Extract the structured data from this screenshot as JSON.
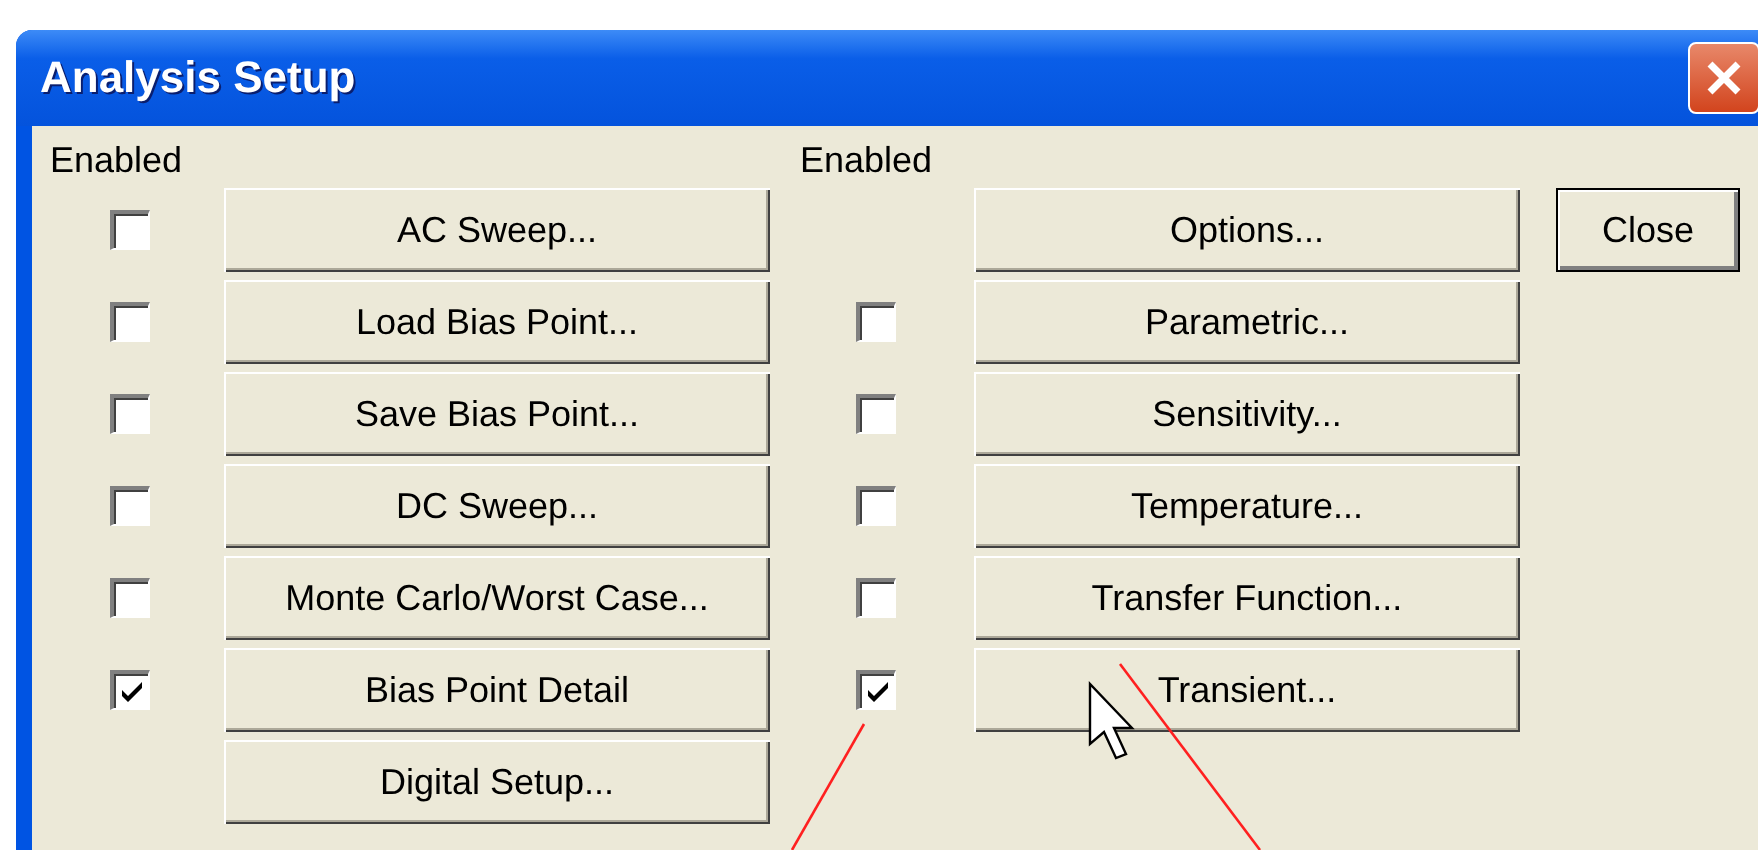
{
  "window": {
    "title": "Analysis Setup"
  },
  "left": {
    "header": "Enabled",
    "rows": [
      {
        "kind": "check",
        "checked": false,
        "label": "AC Sweep..."
      },
      {
        "kind": "check",
        "checked": false,
        "label": "Load Bias Point..."
      },
      {
        "kind": "check",
        "checked": false,
        "label": "Save Bias Point..."
      },
      {
        "kind": "check",
        "checked": false,
        "label": "DC Sweep..."
      },
      {
        "kind": "check",
        "checked": false,
        "label": "Monte Carlo/Worst Case..."
      },
      {
        "kind": "check",
        "checked": true,
        "label": "Bias Point Detail"
      },
      {
        "kind": "plain",
        "label": "Digital Setup..."
      }
    ]
  },
  "right": {
    "header": "Enabled",
    "rows": [
      {
        "kind": "plain",
        "label": "Options..."
      },
      {
        "kind": "check",
        "checked": false,
        "label": "Parametric..."
      },
      {
        "kind": "check",
        "checked": false,
        "label": "Sensitivity..."
      },
      {
        "kind": "check",
        "checked": false,
        "label": "Temperature..."
      },
      {
        "kind": "check",
        "checked": false,
        "label": "Transfer Function..."
      },
      {
        "kind": "check",
        "checked": true,
        "label": "Transient..."
      }
    ]
  },
  "close_button": "Close"
}
